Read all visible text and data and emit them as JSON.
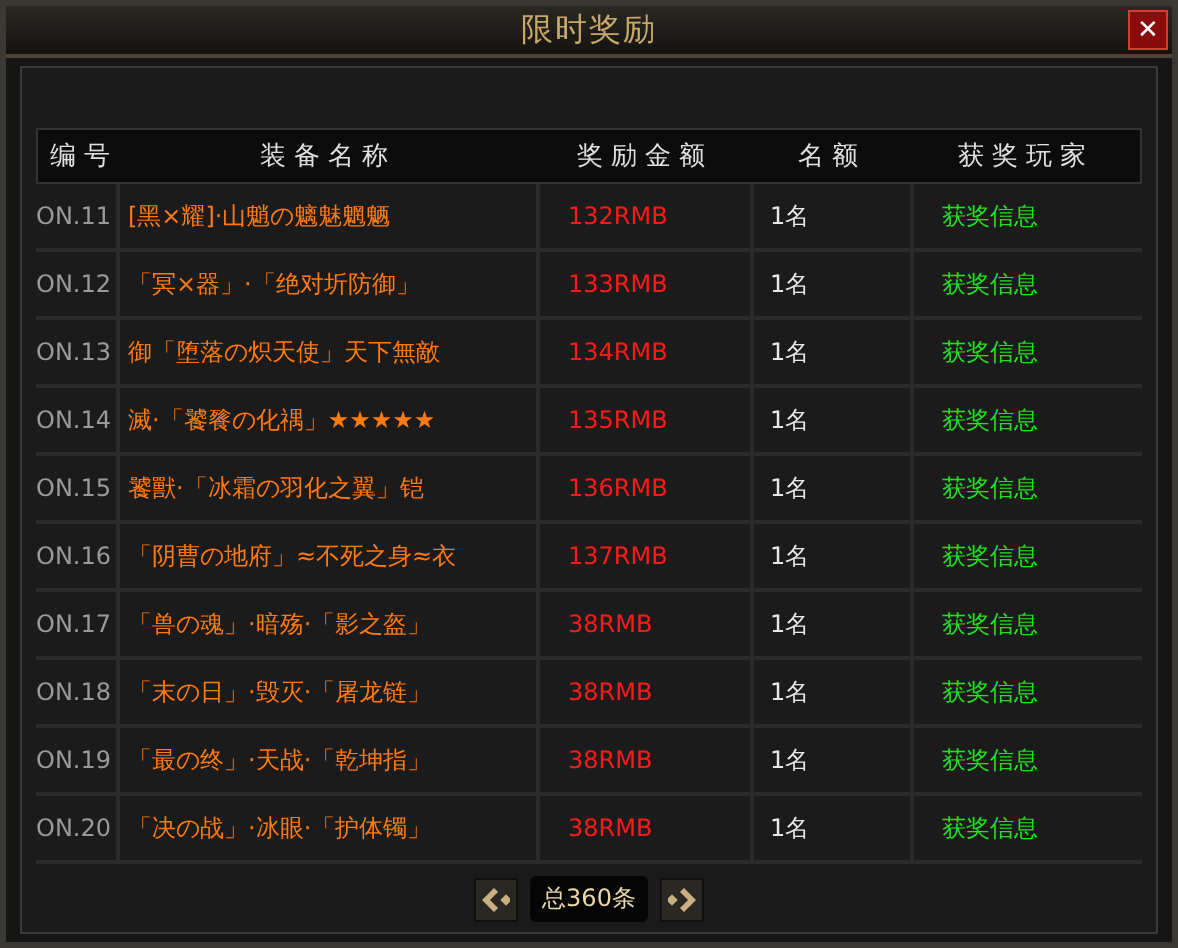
{
  "window": {
    "title": "限时奖励",
    "close": "✕"
  },
  "table": {
    "columns": [
      "编号",
      "装备名称",
      "奖励金额",
      "名额",
      "获奖玩家"
    ],
    "rows": [
      {
        "no": "ON.11",
        "name": "[黑×耀]·山魈の魑魅魍魉",
        "amount": "132RMB",
        "quota": "1名",
        "player": "获奖信息"
      },
      {
        "no": "ON.12",
        "name": "「冥×器」·「绝对圻防御」",
        "amount": "133RMB",
        "quota": "1名",
        "player": "获奖信息"
      },
      {
        "no": "ON.13",
        "name": "御「堕落の炽天使」天下無敵",
        "amount": "134RMB",
        "quota": "1名",
        "player": "获奖信息"
      },
      {
        "no": "ON.14",
        "name": "滅·「饕餮の化禑」★★★★★",
        "amount": "135RMB",
        "quota": "1名",
        "player": "获奖信息"
      },
      {
        "no": "ON.15",
        "name": "饕獸·「冰霜の羽化之翼」铠",
        "amount": "136RMB",
        "quota": "1名",
        "player": "获奖信息"
      },
      {
        "no": "ON.16",
        "name": "「阴曹の地府」≈不死之身≈衣",
        "amount": "137RMB",
        "quota": "1名",
        "player": "获奖信息"
      },
      {
        "no": "ON.17",
        "name": "「兽の魂」·暗殇·「影之盔」",
        "amount": "38RMB",
        "quota": "1名",
        "player": "获奖信息"
      },
      {
        "no": "ON.18",
        "name": "「末の日」·毁灭·「屠龙链」",
        "amount": "38RMB",
        "quota": "1名",
        "player": "获奖信息"
      },
      {
        "no": "ON.19",
        "name": "「最の终」·天战·「乾坤指」",
        "amount": "38RMB",
        "quota": "1名",
        "player": "获奖信息"
      },
      {
        "no": "ON.20",
        "name": "「决の战」·冰眼·「护体镯」",
        "amount": "38RMB",
        "quota": "1名",
        "player": "获奖信息"
      }
    ]
  },
  "pagination": {
    "total": "总360条"
  }
}
